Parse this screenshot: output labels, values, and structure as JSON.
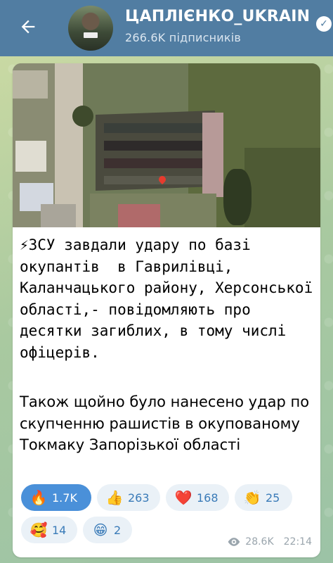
{
  "header": {
    "channel_title": "ЦАПЛІЄНКО_UKRAIN",
    "subscribers": "266.6K підписників",
    "back_icon": "arrow-left-icon",
    "verified_icon": "verified-badge-icon"
  },
  "message": {
    "paragraph1": "⚡ЗСУ завдали удару по базі окупантів  в Гаврилівці, Каланчацького району, Херсонської області,- повідомляють про десятки загиблих, в тому числі офіцерів.",
    "paragraph2": "Також щойно було нанесено удар по скупченню рашистів в окупованому Токмаку Запорізької області"
  },
  "reactions": [
    {
      "emoji": "🔥",
      "count": "1.7K",
      "active": true
    },
    {
      "emoji": "👍",
      "count": "263",
      "active": false
    },
    {
      "emoji": "❤️",
      "count": "168",
      "active": false
    },
    {
      "emoji": "👏",
      "count": "25",
      "active": false
    },
    {
      "emoji": "🥰",
      "count": "14",
      "active": false
    },
    {
      "emoji": "😁",
      "count": "2",
      "active": false
    }
  ],
  "meta": {
    "views": "28.6K",
    "time": "22:14",
    "eye_icon": "eye-icon"
  },
  "colors": {
    "header_bg": "#517da2",
    "reaction_active": "#4a90d9",
    "reaction_bg": "#eaf1f7"
  }
}
